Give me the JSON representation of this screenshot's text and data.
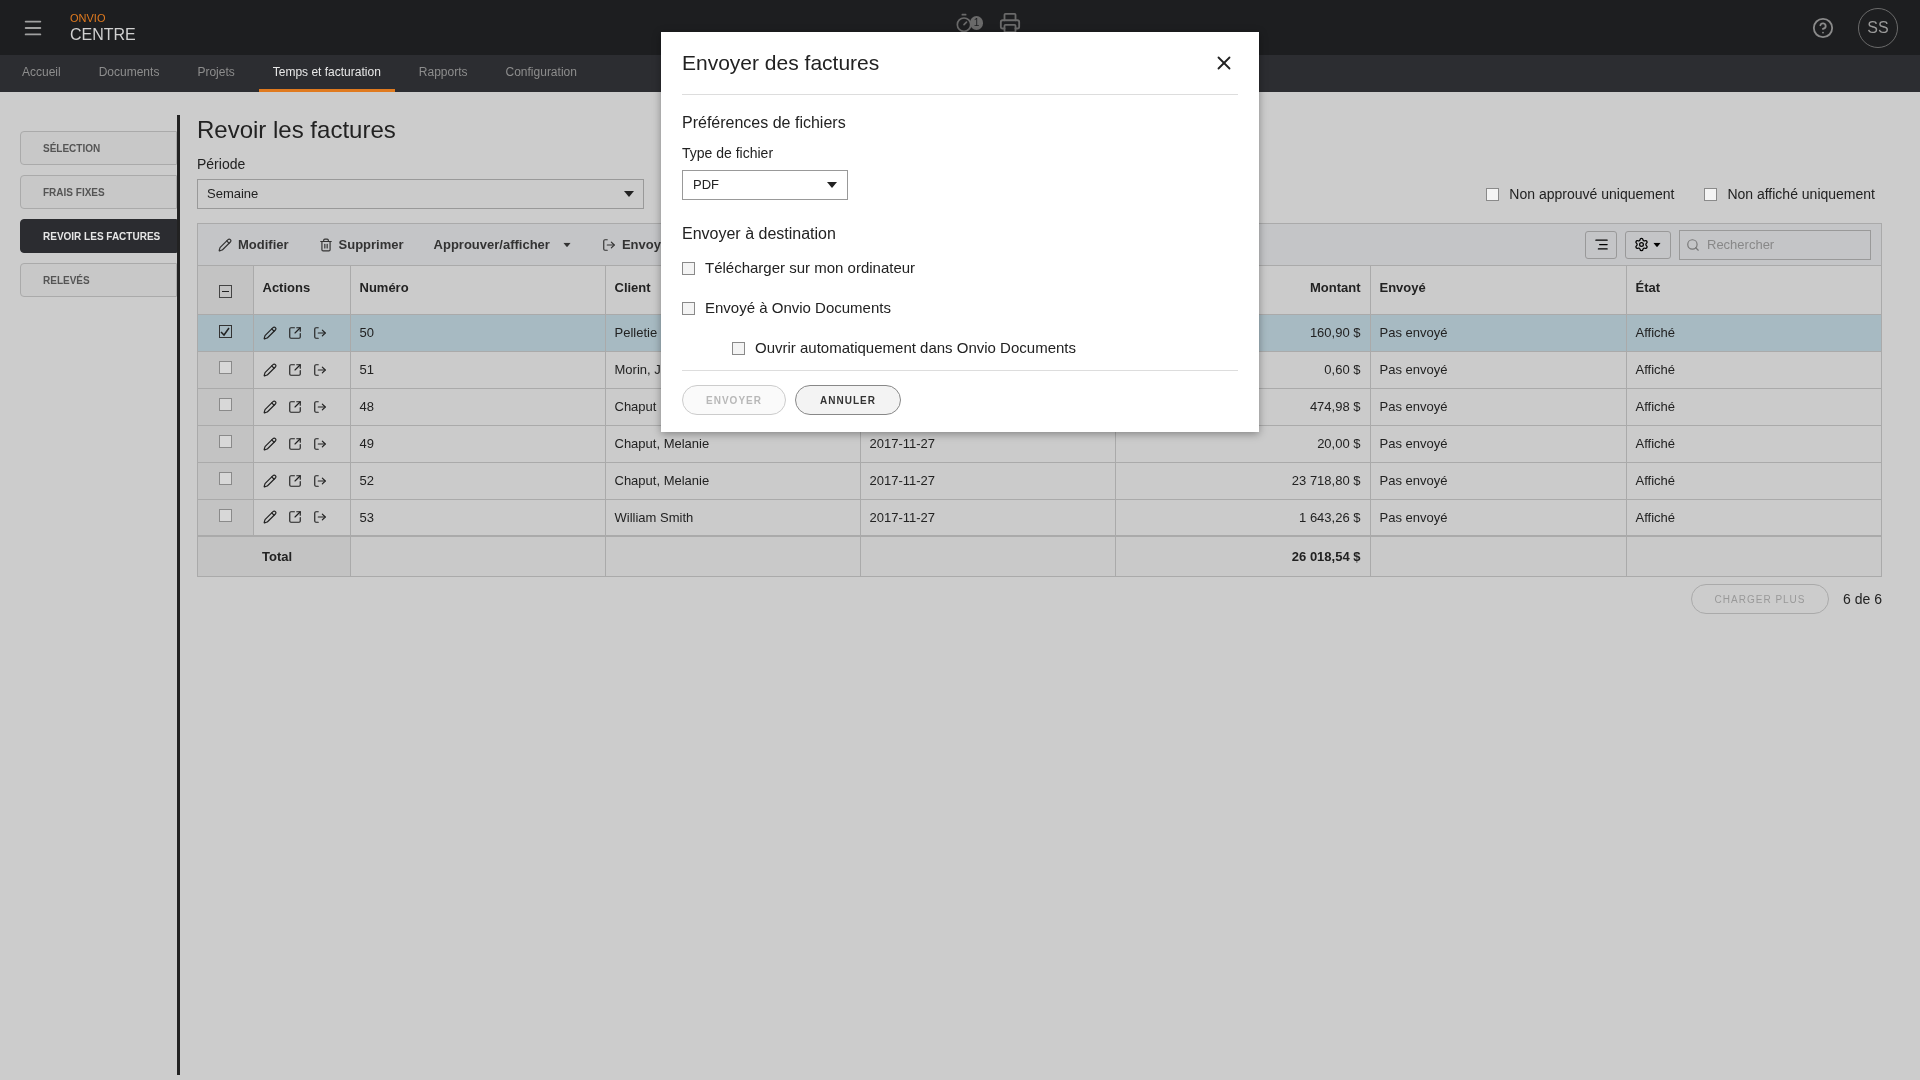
{
  "header": {
    "brand": "ONVIO",
    "product": "CENTRE",
    "timer_badge": "1",
    "avatar": "SS"
  },
  "nav": [
    {
      "label": "Accueil",
      "selected": false
    },
    {
      "label": "Documents",
      "selected": false
    },
    {
      "label": "Projets",
      "selected": false
    },
    {
      "label": "Temps et facturation",
      "selected": true
    },
    {
      "label": "Rapports",
      "selected": false
    },
    {
      "label": "Configuration",
      "selected": false
    }
  ],
  "sidebar": [
    {
      "label": "SÉLECTION",
      "selected": false
    },
    {
      "label": "FRAIS FIXES",
      "selected": false
    },
    {
      "label": "REVOIR LES FACTURES",
      "selected": true
    },
    {
      "label": "RELEVÉS",
      "selected": false
    }
  ],
  "page": {
    "title": "Revoir les factures",
    "period_label": "Période",
    "period_value": "Semaine"
  },
  "filters": [
    {
      "label": "Non approuvé uniquement",
      "checked": false
    },
    {
      "label": "Non affiché uniquement",
      "checked": false
    }
  ],
  "toolbar": {
    "actions": [
      {
        "kind": "edit",
        "label": "Modifier"
      },
      {
        "kind": "delete",
        "label": "Supprimer"
      },
      {
        "kind": "dropdown",
        "label": "Approuver/afficher"
      },
      {
        "kind": "send",
        "label": "Envoy"
      }
    ],
    "search_placeholder": "Rechercher"
  },
  "table": {
    "select_all_indeterminate": true,
    "columns": {
      "actions": "Actions",
      "number": "Numéro",
      "client": "Client",
      "amount": "Montant",
      "sent": "Envoyé",
      "state": "État"
    },
    "rows": [
      {
        "selected": true,
        "number": "50",
        "client": "Pelletie",
        "amount": "160,90 $",
        "sent": "Pas envoyé",
        "state": "Affiché"
      },
      {
        "selected": false,
        "number": "51",
        "client": "Morin, J",
        "amount": "0,60 $",
        "sent": "Pas envoyé",
        "state": "Affiché"
      },
      {
        "selected": false,
        "number": "48",
        "client": "Chaput",
        "amount": "474,98 $",
        "sent": "Pas envoyé",
        "state": "Affiché"
      },
      {
        "selected": false,
        "number": "49",
        "client": "Chaput, Melanie",
        "date": "2017-11-27",
        "amount": "20,00 $",
        "sent": "Pas envoyé",
        "state": "Affiché"
      },
      {
        "selected": false,
        "number": "52",
        "client": "Chaput, Melanie",
        "date": "2017-11-27",
        "amount": "23 718,80 $",
        "sent": "Pas envoyé",
        "state": "Affiché"
      },
      {
        "selected": false,
        "number": "53",
        "client": "William Smith",
        "date": "2017-11-27",
        "amount": "1 643,26 $",
        "sent": "Pas envoyé",
        "state": "Affiché"
      }
    ],
    "total": {
      "label": "Total",
      "amount": "26 018,54 $"
    }
  },
  "pagination": {
    "load_more": "CHARGER PLUS",
    "count": "6 de 6"
  },
  "dialog": {
    "title": "Envoyer des factures",
    "file_section": "Préférences de fichiers",
    "file_type_label": "Type de fichier",
    "file_type_value": "PDF",
    "destination_section": "Envoyer à destination",
    "options": [
      {
        "label": "Télécharger sur mon ordinateur",
        "checked": false
      },
      {
        "label": "Envoyé à Onvio Documents",
        "checked": false,
        "children": [
          {
            "label": "Ouvrir automatiquement dans Onvio Documents",
            "checked": false
          }
        ]
      }
    ],
    "buttons": [
      {
        "label": "ENVOYER",
        "disabled": true
      },
      {
        "label": "ANNULER",
        "disabled": false
      }
    ]
  }
}
